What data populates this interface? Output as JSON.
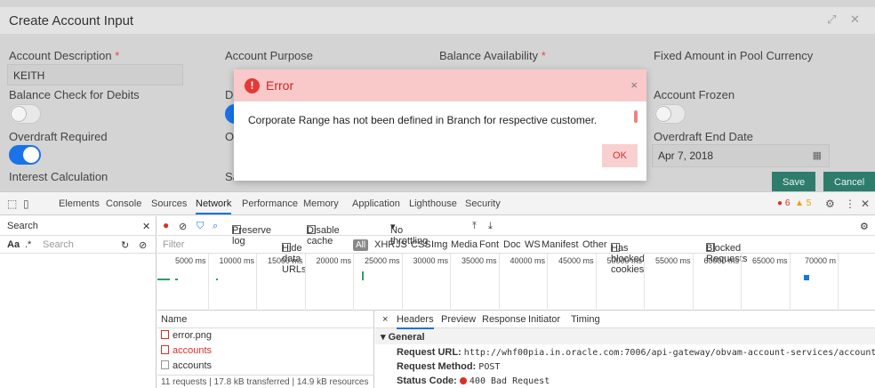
{
  "app": {
    "title": "Create Account Input",
    "window_controls": {
      "expand": "⤢",
      "close": "✕"
    },
    "fields": {
      "account_description_label": "Account Description",
      "account_description_value": "KEITH",
      "account_purpose_label": "Account Purpose",
      "balance_availability_label": "Balance Availability",
      "fixed_amount_label": "Fixed Amount in Pool Currency",
      "balance_check_label": "Balance Check for Debits",
      "de_label_fragment": "De",
      "account_frozen_label": "Account Frozen",
      "overdraft_required_label": "Overdraft Required",
      "ov_label_fragment": "Ov",
      "overdraft_end_date_label": "Overdraft End Date",
      "overdraft_end_date_value": "Apr 7, 2018",
      "interest_calc_label": "Interest Calculation",
      "sa_label_fragment": "Sa"
    },
    "required_mark": "*",
    "buttons": {
      "save": "Save",
      "cancel": "Cancel"
    }
  },
  "modal": {
    "title": "Error",
    "message": "Corporate Range has not been defined in Branch for respective customer.",
    "ok": "OK",
    "close": "×",
    "icon": "!"
  },
  "devtools": {
    "tabs": [
      "Elements",
      "Console",
      "Sources",
      "Network",
      "Performance",
      "Memory",
      "Application",
      "Lighthouse",
      "Security"
    ],
    "active_tab": "Network",
    "error_count": "6",
    "warning_count": "5",
    "search": {
      "label": "Search",
      "case_toggle": "Aa",
      "regex_toggle": ".*",
      "placeholder": "Search"
    },
    "toolbar": {
      "preserve_log": "Preserve log",
      "disable_cache": "Disable cache",
      "throttling": "No throttling"
    },
    "filter": {
      "placeholder": "Filter",
      "hide_data_urls": "Hide data URLs",
      "all": "All",
      "types": [
        "XHR",
        "JS",
        "CSS",
        "Img",
        "Media",
        "Font",
        "Doc",
        "WS",
        "Manifest",
        "Other"
      ],
      "has_blocked_cookies": "Has blocked cookies",
      "blocked_requests": "Blocked Requests"
    },
    "timeline_ticks": [
      "5000 ms",
      "10000 ms",
      "15000 ms",
      "20000 ms",
      "25000 ms",
      "30000 ms",
      "35000 ms",
      "40000 ms",
      "45000 ms",
      "50000 ms",
      "55000 ms",
      "60000 ms",
      "65000 ms",
      "70000 m"
    ],
    "requests": {
      "header": "Name",
      "rows": [
        {
          "name": "error.png",
          "error": false,
          "kind": "img"
        },
        {
          "name": "accounts",
          "error": true,
          "kind": "doc"
        },
        {
          "name": "accounts",
          "error": false,
          "kind": "doc"
        }
      ],
      "summary": "11 requests  |  17.8 kB transferred  |  14.9 kB resources"
    },
    "details": {
      "close": "×",
      "tabs": [
        "Headers",
        "Preview",
        "Response",
        "Initiator",
        "Timing"
      ],
      "active_tab": "Headers",
      "section": "▾ General",
      "request_url_label": "Request URL:",
      "request_url": "http://whf00pia.in.oracle.com:7006/api-gateway/obvam-account-services/accounts",
      "request_method_label": "Request Method:",
      "request_method": "POST",
      "status_code_label": "Status Code:",
      "status_code": "400 Bad Request"
    }
  }
}
